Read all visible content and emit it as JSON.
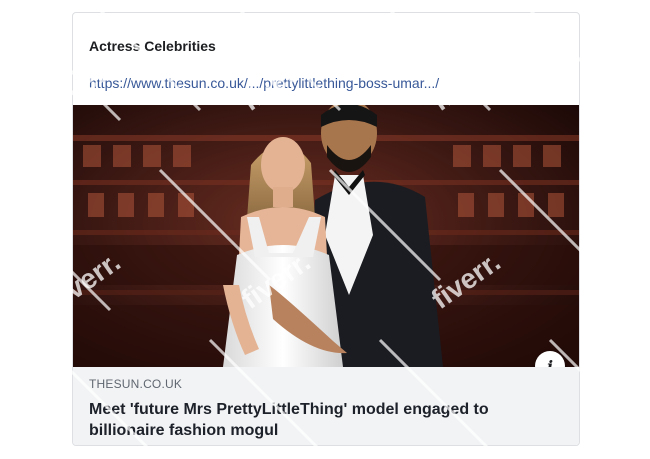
{
  "post": {
    "author": "Actress Celebrities",
    "link_text": "https://www.thesun.co.uk/.../prettylittlething-boss-umar.../"
  },
  "preview": {
    "domain": "THESUN.CO.UK",
    "headline": "Meet 'future Mrs PrettyLittleThing' model engaged to billionaire fashion mogul",
    "info_icon": "info-icon"
  },
  "watermark": {
    "text": "fiverr."
  },
  "colors": {
    "link": "#385898",
    "footer_bg": "#f2f3f5",
    "card_border": "#dddfe2",
    "photo_bg": "#3a1712"
  }
}
